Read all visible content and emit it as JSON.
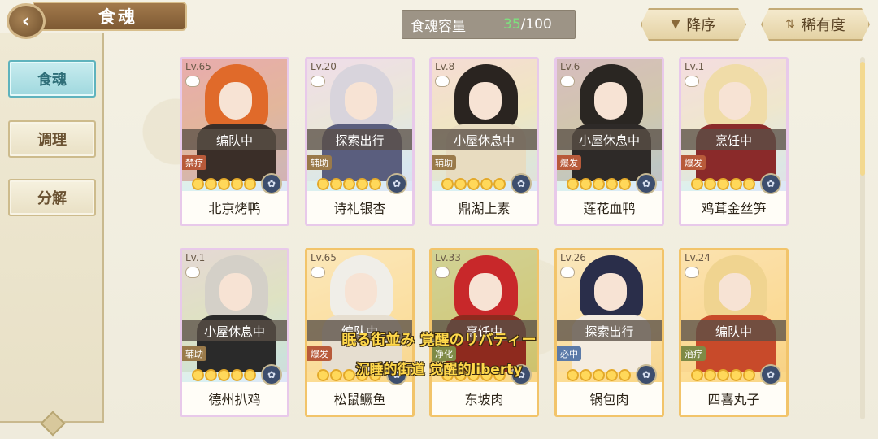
{
  "header": {
    "back_icon": "chevron-left-icon",
    "title": "食魂",
    "capacity_label": "食魂容量",
    "capacity_current": "35",
    "capacity_max": "/100",
    "sort_desc_label": "降序",
    "sort_desc_icon": "triangle-down-icon",
    "sort_rarity_label": "稀有度",
    "sort_rarity_icon": "filter-arrows-icon"
  },
  "sidebar": {
    "items": [
      {
        "label": "食魂",
        "active": true
      },
      {
        "label": "调理",
        "active": false
      },
      {
        "label": "分解",
        "active": false
      }
    ]
  },
  "cards": [
    {
      "level": "Lv.65",
      "status": "编队中",
      "role": "禁疗",
      "stars": 5,
      "name": "北京烤鸭",
      "frame": "rainbow",
      "hair": "#e06a2a",
      "outfit": "#3a2e28",
      "art_bg": "#c44a3a"
    },
    {
      "level": "Lv.20",
      "status": "探索出行",
      "role": "辅助",
      "stars": 5,
      "name": "诗礼银杏",
      "frame": "rainbow",
      "hair": "#d8d4dc",
      "outfit": "#5a5e7e",
      "art_bg": "#d8d6e6"
    },
    {
      "level": "Lv.8",
      "status": "小屋休息中",
      "role": "辅助",
      "stars": 5,
      "name": "鼎湖上素",
      "frame": "rainbow",
      "hair": "#2a2420",
      "outfit": "#e8dcc0",
      "art_bg": "#e8d4a8"
    },
    {
      "level": "Lv.6",
      "status": "小屋休息中",
      "role": "爆发",
      "stars": 5,
      "name": "莲花血鸭",
      "frame": "rainbow",
      "hair": "#2a2622",
      "outfit": "#2e2a28",
      "art_bg": "#8e7a6a"
    },
    {
      "level": "Lv.1",
      "status": "烹饪中",
      "role": "爆发",
      "stars": 5,
      "name": "鸡茸金丝笋",
      "frame": "rainbow",
      "hair": "#f0dca8",
      "outfit": "#8a2a2a",
      "art_bg": "#e4d8c8"
    },
    {
      "level": "Lv.1",
      "status": "小屋休息中",
      "role": "辅助",
      "stars": 5,
      "name": "德州扒鸡",
      "frame": "rainbow",
      "hair": "#d4d0c8",
      "outfit": "#2a2a2a",
      "art_bg": "#b8c8a8"
    },
    {
      "level": "Lv.65",
      "status": "编队中",
      "role": "爆发",
      "stars": 5,
      "name": "松鼠鳜鱼",
      "frame": "gold",
      "hair": "#f0eee8",
      "outfit": "#e6ded0",
      "art_bg": "#f4d8a0"
    },
    {
      "level": "Lv.33",
      "status": "烹饪中",
      "role": "净化",
      "stars": 5,
      "name": "东坡肉",
      "frame": "gold",
      "hair": "#c8282a",
      "outfit": "#8e2a1e",
      "art_bg": "#7a9a3a"
    },
    {
      "level": "Lv.26",
      "status": "探索出行",
      "role": "必中",
      "stars": 5,
      "name": "锅包肉",
      "frame": "gold",
      "hair": "#2a2e4a",
      "outfit": "#f4ece0",
      "art_bg": "#f0d8a8"
    },
    {
      "level": "Lv.24",
      "status": "编队中",
      "role": "治疗",
      "stars": 5,
      "name": "四喜丸子",
      "frame": "gold",
      "hair": "#f0d490",
      "outfit": "#c84a2a",
      "art_bg": "#f4c880"
    }
  ],
  "subtitles": {
    "line1": "眠る街並み 覚醒のリバティー",
    "line2": "沉睡的街道 觉醒的liberty"
  }
}
